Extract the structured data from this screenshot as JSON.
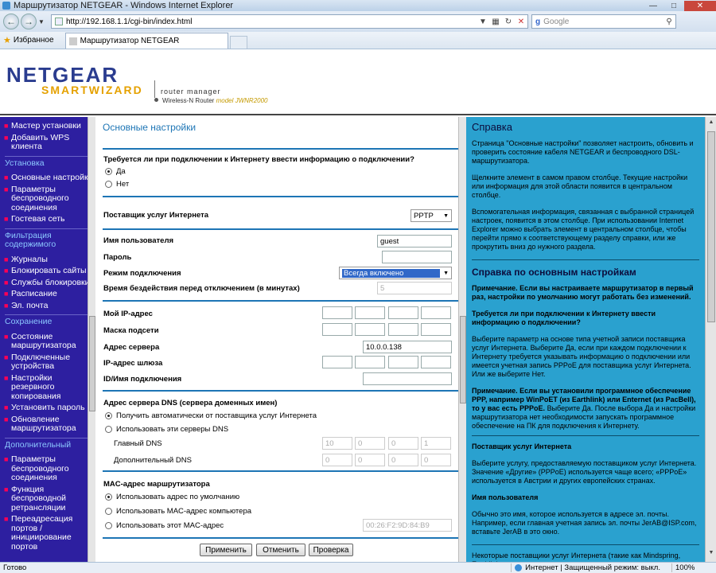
{
  "window": {
    "title": "Маршрутизатор NETGEAR - Windows Internet Explorer"
  },
  "browser": {
    "url": "http://192.168.1.1/cgi-bin/index.html",
    "search_placeholder": "Google",
    "favorites_label": "Избранное",
    "tab_label": "Маршрутизатор NETGEAR"
  },
  "header": {
    "logo_top": "NETGEAR",
    "logo_bottom_a": "SMART",
    "logo_bottom_b": "WIZARD",
    "router_manager": "router manager",
    "model_prefix": "Wireless-N Router",
    "model_name": "model JWNR2000"
  },
  "sidebar": {
    "items_top": [
      "Мастер установки",
      "Добавить WPS клиента"
    ],
    "section_setup": "Установка",
    "items_setup": [
      "Основные настройки",
      "Параметры беспроводного соединения",
      "Гостевая сеть"
    ],
    "section_filter": "Фильтрация содержимого",
    "items_filter": [
      "Журналы",
      "Блокировать сайты",
      "Службы блокировки",
      "Расписание",
      "Эл. почта"
    ],
    "section_maint": "Сохранение",
    "items_maint": [
      "Состояние маршрутизатора",
      "Подключенные устройства",
      "Настройки резервного копирования",
      "Установить пароль",
      "Обновление маршрутизатора"
    ],
    "section_adv": "Дополнительный",
    "items_adv": [
      "Параметры беспроводного соединения",
      "Функция беспроводной ретрансляции",
      "Переадресация портов / инициирование портов"
    ]
  },
  "main": {
    "title": "Основные настройки",
    "q_login": "Требуется ли при подключении к Интернету ввести информацию о подключении?",
    "opt_yes": "Да",
    "opt_no": "Нет",
    "isp_label": "Поставщик услуг Интернета",
    "isp_value": "PPTP",
    "username_label": "Имя пользователя",
    "username_value": "guest",
    "password_label": "Пароль",
    "mode_label": "Режим подключения",
    "mode_value": "Всегда включено",
    "idle_label": "Время бездействия перед отключением (в минутах)",
    "idle_value": "5",
    "myip_label": "Мой IP-адрес",
    "mask_label": "Маска подсети",
    "server_label": "Адрес сервера",
    "server_value": "10.0.0.138",
    "gateway_label": "IP-адрес шлюза",
    "conn_id_label": "ID/Имя подключения",
    "dns_section": "Адрес сервера DNS (сервера доменных имен)",
    "dns_auto": "Получить автоматически от поставщика услуг Интернета",
    "dns_manual": "Использовать эти серверы DNS",
    "dns_primary_label": "Главный DNS",
    "dns_primary": [
      "10",
      "0",
      "0",
      "1"
    ],
    "dns_secondary_label": "Дополнительный DNS",
    "dns_secondary": [
      "0",
      "0",
      "0",
      "0"
    ],
    "mac_section": "MAC-адрес маршрутизатора",
    "mac_default": "Использовать адрес по умолчанию",
    "mac_computer": "Использовать MAC-адрес компьютера",
    "mac_this": "Использовать этот MAC-адрес",
    "mac_value": "00:26:F2:9D:84:B9",
    "btn_apply": "Применить",
    "btn_cancel": "Отменить",
    "btn_test": "Проверка"
  },
  "help": {
    "h1": "Справка",
    "p1": "Страница \"Основные настройки\" позволяет настроить, обновить и проверить состояние кабеля NETGEAR и беспроводного DSL-маршрутизатора.",
    "p2": "Щелкните элемент в самом правом столбце. Текущие настройки или информация для этой области появится в центральном столбце.",
    "p3": "Вспомогательная информация, связанная с выбранной страницей настроек, появится в этом столбце. При использовании Internet Explorer можно выбрать элемент в центральном столбце, чтобы перейти прямо к соответствующему разделу справки, или же прокрутить вниз до нужного раздела.",
    "h2": "Справка по основным настройкам",
    "note1": "Примечание. Если вы настраиваете маршрутизатор в первый раз, настройки по умолчанию могут работать без изменений.",
    "q1": "Требуется ли при подключении к Интернету ввести информацию о подключении?",
    "p4": "Выберите параметр на основе типа учетной записи поставщика услуг Интернета. Выберите Да, если при каждом подключении к Интернету требуется указывать информацию о подключении или имеется учетная запись PPPoE для поставщика услуг Интернета. Или же выберите Нет.",
    "note2": "Примечание. Если вы установили программное обеспечение PPP, например WinPoET (из Earthlink) или Enternet (из PacBell), то у вас есть PPPoE.",
    "p5": "Выберите Да. После выбора Да и настройки маршрутизатора нет необходимости запускать программное обеспечение на ПК для подключения к Интернету.",
    "s_isp": "Поставщик услуг Интернета",
    "p6": "Выберите услугу, предоставляемую поставщиком услуг Интернета. Значение «Другие» (PPPoE) используется чаще всего; «PPPoE» используется в Австрии и других европейских странах.",
    "s_user": "Имя пользователя",
    "p7": "Обычно это имя, которое используется в адресе эл. почты. Например, если главная учетная запись эл. почты JerAB@ISP.com, вставьте JerAB в это окно.",
    "p8": "Некоторые поставщики услуг Интернета (такие как Mindspring, Earthlink"
  },
  "status": {
    "text": "Готово",
    "zone": "Интернет | Защищенный режим: выкл.",
    "zoom": "100%"
  }
}
